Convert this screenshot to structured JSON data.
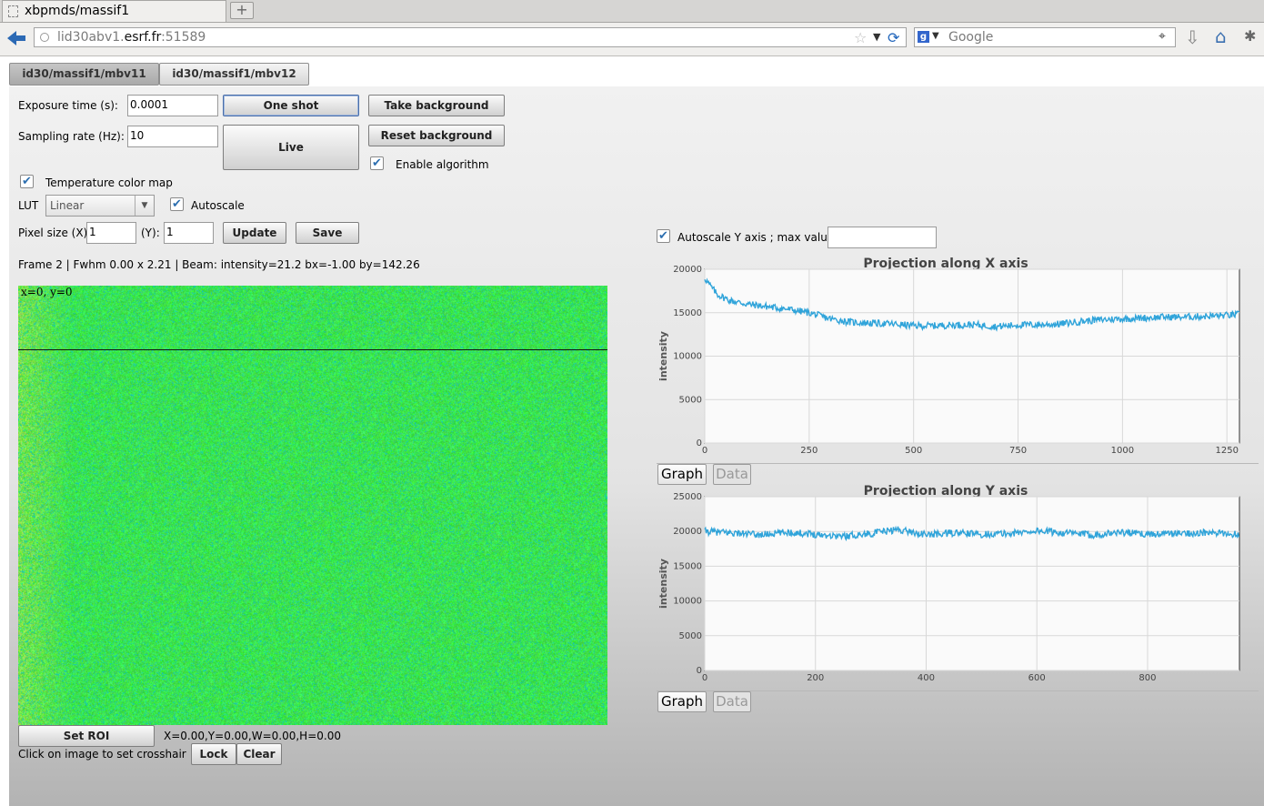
{
  "browser": {
    "tab_title": "xbpmds/massif1",
    "url_host_prefix": "lid30abv1.",
    "url_host_main": "esrf.fr",
    "url_port": ":51589",
    "search_placeholder": "Google"
  },
  "device_tabs": [
    {
      "label": "id30/massif1/mbv11",
      "active": true
    },
    {
      "label": "id30/massif1/mbv12",
      "active": false
    }
  ],
  "controls": {
    "exposure_label": "Exposure time (s):",
    "exposure_value": "0.0001",
    "sampling_label": "Sampling rate (Hz):",
    "sampling_value": "10",
    "one_shot": "One shot",
    "live": "Live",
    "take_background": "Take background",
    "reset_background": "Reset background",
    "enable_algorithm": "Enable algorithm",
    "enable_algorithm_checked": true,
    "temperature_color_map": "Temperature color map",
    "temperature_color_map_checked": true,
    "lut_label": "LUT",
    "lut_value": "Linear",
    "autoscale": "Autoscale",
    "autoscale_checked": true,
    "pixel_size_label": "Pixel size (X):",
    "pixel_x": "1",
    "y_label": "(Y):",
    "pixel_y": "1",
    "update": "Update",
    "save": "Save",
    "frame_info": "Frame 2 | Fwhm 0.00 x 2.21 | Beam: intensity=21.2 bx=-1.00 by=142.26",
    "coord_readout": "x=0, y=0",
    "set_roi": "Set ROI",
    "roi_readout": "X=0.00,Y=0.00,W=0.00,H=0.00",
    "crosshair_hint": "Click on image to set crosshair",
    "lock": "Lock",
    "clear": "Clear",
    "autoscale_y_label": "Autoscale Y axis ; max value =",
    "autoscale_y_checked": true,
    "max_value": ""
  },
  "graph_tabs": {
    "graph": "Graph",
    "data": "Data"
  },
  "colors": {
    "series": "#1a9ad6",
    "image_green": "#33ee33"
  },
  "chart_data": [
    {
      "type": "line",
      "title": "Projection along X axis",
      "xlabel": "",
      "ylabel": "intensity",
      "xlim": [
        0,
        1280
      ],
      "ylim": [
        0,
        20000
      ],
      "xticks": [
        0,
        250,
        500,
        750,
        1000,
        1250
      ],
      "yticks": [
        0,
        5000,
        10000,
        15000,
        20000
      ],
      "grid": true,
      "series": [
        {
          "x": [
            0,
            10,
            30,
            60,
            100,
            150,
            200,
            250,
            300,
            350,
            400,
            450,
            500,
            550,
            600,
            650,
            700,
            750,
            800,
            850,
            900,
            950,
            1000,
            1050,
            1100,
            1150,
            1200,
            1250,
            1280
          ],
          "values": [
            19000,
            18300,
            17100,
            16400,
            16000,
            15700,
            15400,
            15000,
            14300,
            13900,
            13800,
            13700,
            13500,
            13500,
            13600,
            13600,
            13400,
            13600,
            13600,
            13700,
            14000,
            14200,
            14300,
            14400,
            14500,
            14500,
            14600,
            14700,
            14800
          ]
        }
      ]
    },
    {
      "type": "line",
      "title": "Projection along Y axis",
      "xlabel": "",
      "ylabel": "intensity",
      "xlim": [
        0,
        966
      ],
      "ylim": [
        0,
        25000
      ],
      "xticks": [
        0,
        200,
        400,
        600,
        800
      ],
      "yticks": [
        0,
        5000,
        10000,
        15000,
        20000,
        25000
      ],
      "grid": true,
      "series": [
        {
          "x": [
            0,
            50,
            100,
            150,
            200,
            250,
            300,
            350,
            400,
            450,
            500,
            550,
            600,
            650,
            700,
            750,
            800,
            850,
            900,
            966
          ],
          "values": [
            20000,
            19800,
            19500,
            19900,
            19600,
            19300,
            19700,
            20300,
            19500,
            19800,
            19600,
            19700,
            20100,
            19800,
            19500,
            19900,
            19600,
            19700,
            19800,
            19600
          ]
        }
      ]
    }
  ]
}
